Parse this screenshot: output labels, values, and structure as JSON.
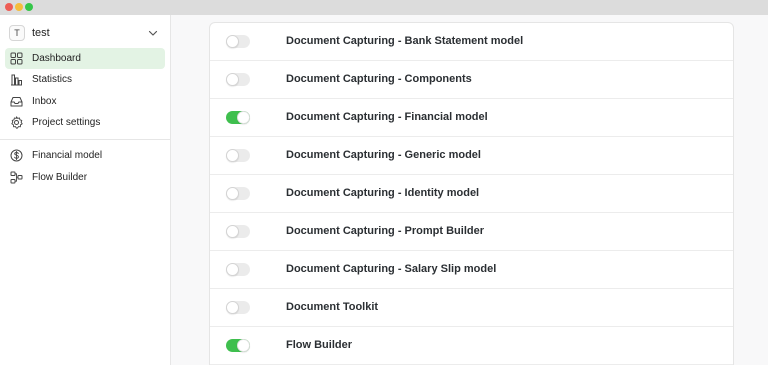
{
  "window": {
    "controls": [
      "close",
      "minimize",
      "zoom"
    ]
  },
  "sidebar": {
    "project": {
      "avatar": "T",
      "name": "test"
    },
    "items": [
      {
        "label": "Dashboard",
        "icon": "grid-icon",
        "active": true
      },
      {
        "label": "Statistics",
        "icon": "bar-chart-icon",
        "active": false
      },
      {
        "label": "Inbox",
        "icon": "inbox-icon",
        "active": false
      },
      {
        "label": "Project settings",
        "icon": "gear-icon",
        "active": false
      }
    ],
    "secondary_items": [
      {
        "label": "Financial model",
        "icon": "dollar-circle-icon"
      },
      {
        "label": "Flow Builder",
        "icon": "flow-icon"
      }
    ]
  },
  "modules": [
    {
      "label": "Document Capturing - Bank Statement model",
      "enabled": false
    },
    {
      "label": "Document Capturing - Components",
      "enabled": false
    },
    {
      "label": "Document Capturing - Financial model",
      "enabled": true
    },
    {
      "label": "Document Capturing - Generic model",
      "enabled": false
    },
    {
      "label": "Document Capturing - Identity model",
      "enabled": false
    },
    {
      "label": "Document Capturing - Prompt Builder",
      "enabled": false
    },
    {
      "label": "Document Capturing - Salary Slip model",
      "enabled": false
    },
    {
      "label": "Document Toolkit",
      "enabled": false
    },
    {
      "label": "Flow Builder",
      "enabled": true
    }
  ],
  "colors": {
    "accent": "#3fbf4e",
    "active_nav_bg": "#e3f3e4",
    "toggle_off": "#ebebeb"
  }
}
